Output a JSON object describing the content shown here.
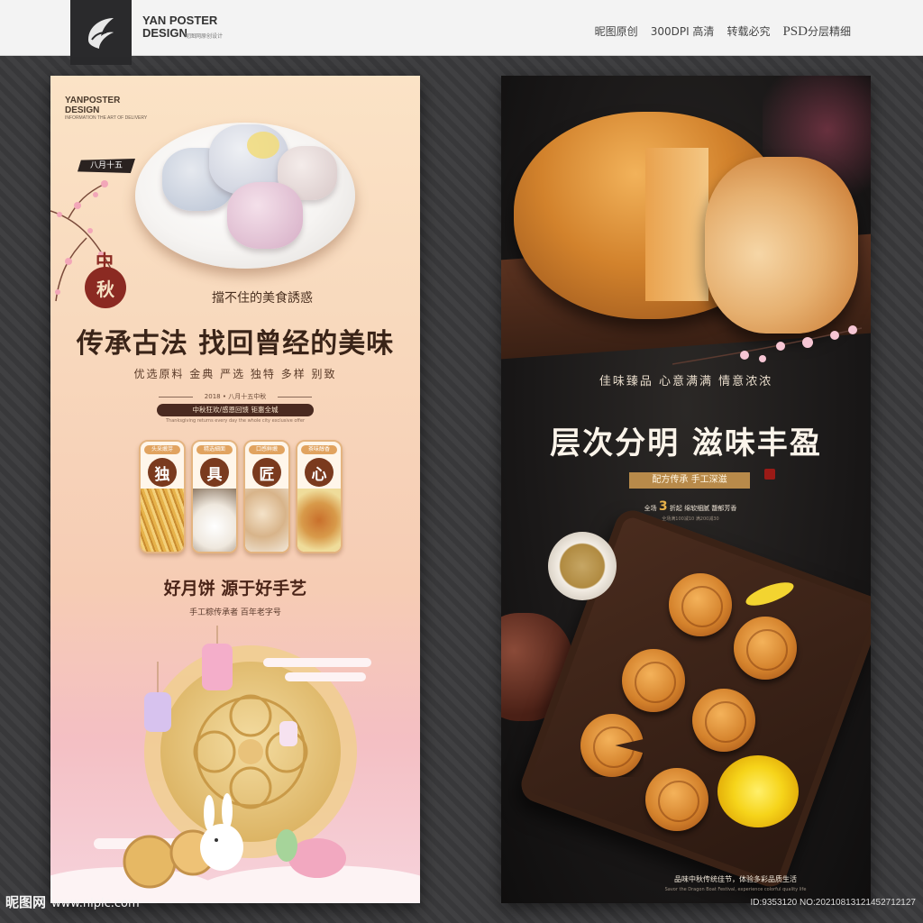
{
  "header": {
    "brand_line1": "YAN POSTER",
    "brand_line2": "DESIGN",
    "brand_sub": "昵图网原创设计",
    "links": [
      "昵图原创",
      "300DPI 高清",
      "转载必究"
    ],
    "psd_label": "PSD",
    "psd_suffix": "分层精细"
  },
  "left_poster": {
    "brand_line1": "YANPOSTER",
    "brand_line2": "DESIGN",
    "brand_info": "INFORMATION THE ART OF DELIVERY",
    "date_tag": "八月十五",
    "badge_top": "中",
    "badge_char": "秋",
    "subtitle": "擋不住的美食誘惑",
    "title": "传承古法 找回曾经的美味",
    "selling_points": "优选原料 金典 严选 独特 多样 别致",
    "festival_date": "2018 • 八月十五中秋",
    "pill_text": "中秋狂欢/感恩回馈 钜惠全城",
    "tiny_text": "Thanksgiving returns every day the whole city exclusive offer",
    "cards": [
      {
        "label": "头采嫩芽",
        "char": "独"
      },
      {
        "label": "精选細面",
        "char": "具"
      },
      {
        "label": "口感鲜嫩",
        "char": "匠"
      },
      {
        "label": "茶味醇香",
        "char": "心"
      }
    ],
    "slogan": "好月饼 源于好手艺",
    "slogan_sub": "手工粽传承者 百年老字号"
  },
  "right_poster": {
    "tagline": "佳味臻品 心意满满 情意浓浓",
    "title": "层次分明 滋味丰盈",
    "banner": "配方传承 手工深滋",
    "promo_prefix": "全场",
    "promo_big": "3",
    "promo_suffix": "折起 绵软细腻 馥郁芳香",
    "promo_sub": "全场满100减10 满200减30",
    "bottom_text": "品味中秋传统佳节，体验多彩品质生活",
    "bottom_sub": "Savor the Dragon Boat Festival, experience colorful quality life"
  },
  "footer": {
    "site": "昵图网",
    "url": "www.nipic.com",
    "id_text": "ID:9353120 NO:20210813121452712127"
  },
  "colors": {
    "accent_brown": "#4a2418",
    "gold": "#e1a35f",
    "red_badge": "#8b2a22"
  }
}
